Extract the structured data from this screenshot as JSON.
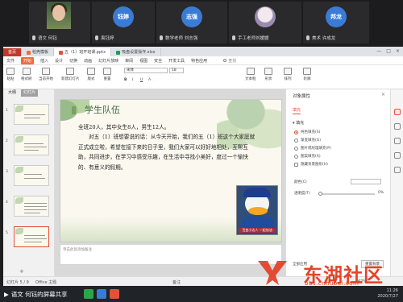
{
  "participants": [
    {
      "name": "语文 何钰",
      "type": "video"
    },
    {
      "avatar_text": "钰婷",
      "name": "袁钰婷",
      "color": "#3a7bd5"
    },
    {
      "avatar_text": "志强",
      "name": "数学老师 刘志强",
      "color": "#3a7bd5"
    },
    {
      "name": "手工老师刘嫒嫒",
      "type": "photo"
    },
    {
      "avatar_text": "邦龙",
      "name": "美术 许成龙",
      "color": "#3a7bd5"
    }
  ],
  "tabs": [
    {
      "label": "首页",
      "color": "#ffffff"
    },
    {
      "label": "稻壳模板",
      "color": "#f26b3a"
    },
    {
      "label": "五（1）班开班课.pptx",
      "color": "#e0533b"
    },
    {
      "label": "吸盘设置操作.xlsx",
      "color": "#1e9e55"
    }
  ],
  "menu": {
    "start": "开始",
    "items": [
      "文件",
      "插入",
      "设计",
      "切换",
      "动画",
      "幻灯片放映",
      "审阅",
      "视图",
      "安全",
      "开发工具",
      "特色应用"
    ],
    "search": "查找"
  },
  "ribbon": {
    "groups": [
      "粘贴",
      "格式刷",
      "当前开始",
      "新建幻灯片",
      "版式",
      "重置"
    ],
    "font_name": "宋体",
    "font_size": "18",
    "right_groups": [
      "文本框",
      "形状",
      "排列",
      "轮廓"
    ]
  },
  "thumbnails": {
    "tab_outline": "大纲",
    "tab_slides": "幻灯片",
    "numbers": [
      "1",
      "2",
      "3",
      "4",
      "5"
    ],
    "selected_index": 4,
    "add": "+"
  },
  "slide": {
    "title": "学生队伍",
    "para1": "全班20人，其中女生8人，男生12人。",
    "para2": "对五（1）班想要说的话：从今天开始，我们的五（1）班这个大家庭就正式成立啦，希望在接下来的日子里，我们大家可以好好地相处，互帮互助，共同进步，在学习中感受乐趣，在生活中寻找小美好，度过一个愉快的、有意义的假期。",
    "photo_caption": "百变小达人 一起加油",
    "notes_placeholder": "单击此处添加备注"
  },
  "props": {
    "title": "对象属性",
    "close": "×",
    "tab": "填充",
    "section": "▾ 填充",
    "options": [
      "纯色填充(S)",
      "渐变填充(G)",
      "图片或纹理填充(P)",
      "图案填充(A)",
      "隐藏背景图形(H)"
    ],
    "selected_option": 0,
    "color_label": "颜色(C)",
    "transparency_label": "透明度(T)",
    "transparency_value": "0%",
    "footer": "全部应用",
    "reset_button": "重置背景"
  },
  "status": {
    "slide_of": "幻灯片 5 / 9",
    "theme": "Office 主题",
    "notes": "备注",
    "zoom": "67%"
  },
  "watermark": {
    "text": "东湖社区",
    "url": "bbs.cnhubei.com"
  },
  "taskbar": {
    "share_text": "语文 何钰的屏幕共享",
    "time": "11:26",
    "date": "2020/7/27"
  }
}
